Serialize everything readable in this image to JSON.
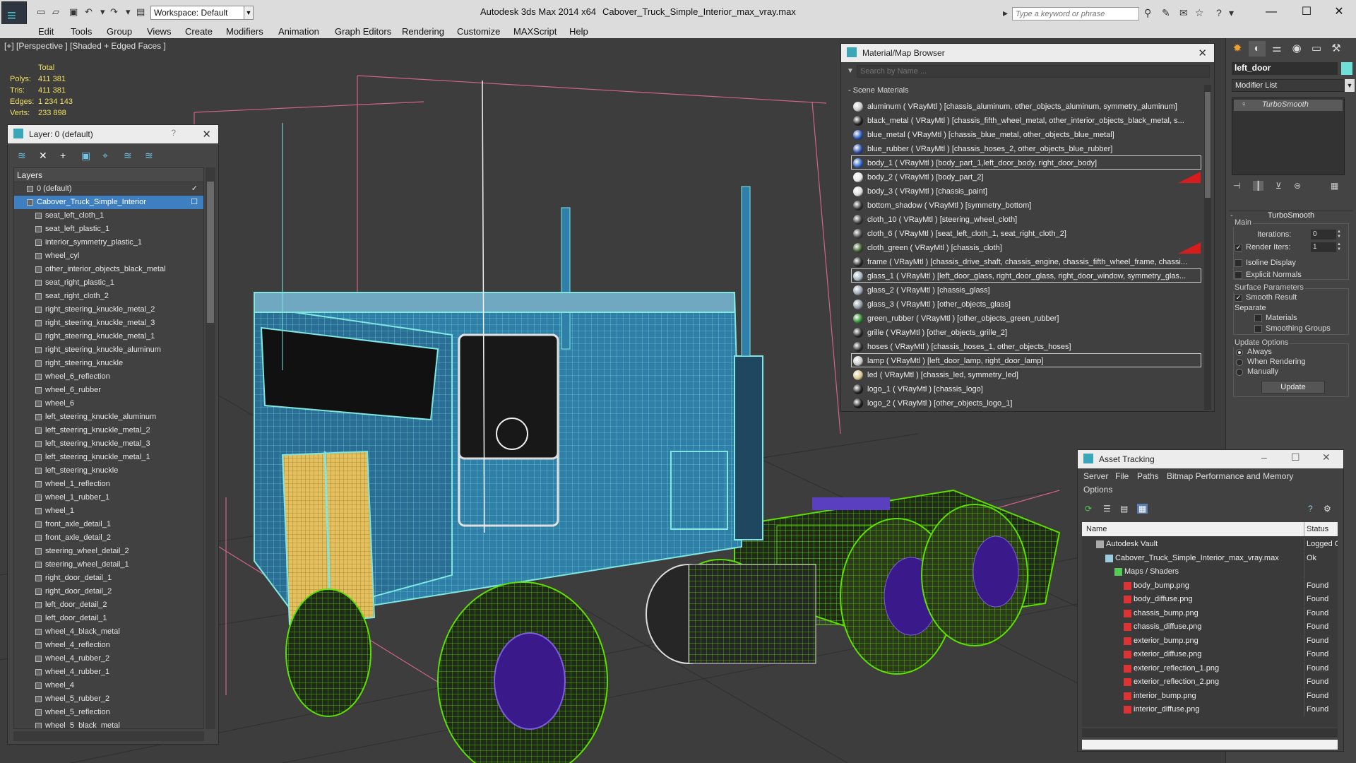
{
  "titlebar": {
    "workspace": "Workspace: Default",
    "app_title": "Autodesk 3ds Max  2014 x64",
    "file_title": "Cabover_Truck_Simple_Interior_max_vray.max",
    "search_placeholder": "Type a keyword or phrase",
    "minimize": "—",
    "maximize": "☐",
    "close": "✕"
  },
  "menubar": [
    "Edit",
    "Tools",
    "Group",
    "Views",
    "Create",
    "Modifiers",
    "Animation",
    "Graph Editors",
    "Rendering",
    "Customize",
    "MAXScript",
    "Help"
  ],
  "viewport": {
    "label": "[+] [Perspective ] [Shaded + Edged Faces ]",
    "stats": {
      "total_label": "Total",
      "polys_label": "Polys:",
      "polys": "411 381",
      "tris_label": "Tris:",
      "tris": "411 381",
      "edges_label": "Edges:",
      "edges": "1 234 143",
      "verts_label": "Verts:",
      "verts": "233 898"
    }
  },
  "layer_panel": {
    "title": "Layer: 0 (default)",
    "help": "?",
    "close": "✕",
    "header": "Layers",
    "items": [
      {
        "label": "0 (default)",
        "level": 0,
        "check": "✓"
      },
      {
        "label": "Cabover_Truck_Simple_Interior",
        "level": 0,
        "selected": true,
        "check": "☐"
      },
      {
        "label": "seat_left_cloth_1",
        "level": 1
      },
      {
        "label": "seat_left_plastic_1",
        "level": 1
      },
      {
        "label": "interior_symmetry_plastic_1",
        "level": 1
      },
      {
        "label": "wheel_cyl",
        "level": 1
      },
      {
        "label": "other_interior_objects_black_metal",
        "level": 1
      },
      {
        "label": "seat_right_plastic_1",
        "level": 1
      },
      {
        "label": "seat_right_cloth_2",
        "level": 1
      },
      {
        "label": "right_steering_knuckle_metal_2",
        "level": 1
      },
      {
        "label": "right_steering_knuckle_metal_3",
        "level": 1
      },
      {
        "label": "right_steering_knuckle_metal_1",
        "level": 1
      },
      {
        "label": "right_steering_knuckle_aluminum",
        "level": 1
      },
      {
        "label": "right_steering_knuckle",
        "level": 1
      },
      {
        "label": "wheel_6_reflection",
        "level": 1
      },
      {
        "label": "wheel_6_rubber",
        "level": 1
      },
      {
        "label": "wheel_6",
        "level": 1
      },
      {
        "label": "left_steering_knuckle_aluminum",
        "level": 1
      },
      {
        "label": "left_steering_knuckle_metal_2",
        "level": 1
      },
      {
        "label": "left_steering_knuckle_metal_3",
        "level": 1
      },
      {
        "label": "left_steering_knuckle_metal_1",
        "level": 1
      },
      {
        "label": "left_steering_knuckle",
        "level": 1
      },
      {
        "label": "wheel_1_reflection",
        "level": 1
      },
      {
        "label": "wheel_1_rubber_1",
        "level": 1
      },
      {
        "label": "wheel_1",
        "level": 1
      },
      {
        "label": "front_axle_detail_1",
        "level": 1
      },
      {
        "label": "front_axle_detail_2",
        "level": 1
      },
      {
        "label": "steering_wheel_detail_2",
        "level": 1
      },
      {
        "label": "steering_wheel_detail_1",
        "level": 1
      },
      {
        "label": "right_door_detail_1",
        "level": 1
      },
      {
        "label": "right_door_detail_2",
        "level": 1
      },
      {
        "label": "left_door_detail_2",
        "level": 1
      },
      {
        "label": "left_door_detail_1",
        "level": 1
      },
      {
        "label": "wheel_4_black_metal",
        "level": 1
      },
      {
        "label": "wheel_4_reflection",
        "level": 1
      },
      {
        "label": "wheel_4_rubber_2",
        "level": 1
      },
      {
        "label": "wheel_4_rubber_1",
        "level": 1
      },
      {
        "label": "wheel_4",
        "level": 1
      },
      {
        "label": "wheel_5_rubber_2",
        "level": 1
      },
      {
        "label": "wheel_5_reflection",
        "level": 1
      },
      {
        "label": "wheel_5_black_metal",
        "level": 1
      }
    ]
  },
  "material_browser": {
    "title": "Material/Map Browser",
    "close": "✕",
    "search_placeholder": "Search by Name ...",
    "group": "- Scene Materials",
    "items": [
      {
        "label": "aluminum  ( VRayMtl ) [chassis_aluminum, other_objects_aluminum, symmetry_aluminum]",
        "color": "#c9c9c9"
      },
      {
        "label": "black_metal  ( VRayMtl ) [chassis_fifth_wheel_metal, other_interior_objects_black_metal, s...",
        "color": "#222222"
      },
      {
        "label": "blue_metal  ( VRayMtl ) [chassis_blue_metal, other_objects_blue_metal]",
        "color": "#2a58b8"
      },
      {
        "label": "blue_rubber  ( VRayMtl ) [chassis_hoses_2, other_objects_blue_rubber]",
        "color": "#2b4fa8"
      },
      {
        "label": "body_1  ( VRayMtl ) [body_part_1,left_door_body, right_door_body]",
        "color": "#2f66c4",
        "boxed": true
      },
      {
        "label": "body_2  ( VRayMtl ) [body_part_2]",
        "color": "#e8e8e8",
        "flag": true
      },
      {
        "label": "body_3  ( VRayMtl ) [chassis_paint]",
        "color": "#dddddd"
      },
      {
        "label": "bottom_shadow  ( VRayMtl ) [symmetry_bottom]",
        "color": "#333333"
      },
      {
        "label": "cloth_10  ( VRayMtl ) [steering_wheel_cloth]",
        "color": "#3a3a3a"
      },
      {
        "label": "cloth_6  ( VRayMtl ) [seat_left_cloth_1, seat_right_cloth_2]",
        "color": "#444444"
      },
      {
        "label": "cloth_green  ( VRayMtl ) [chassis_cloth]",
        "color": "#3d5a2a",
        "flag": true
      },
      {
        "label": "frame  ( VRayMtl ) [chassis_drive_shaft, chassis_engine, chassis_fifth_wheel_frame, chassi...",
        "color": "#2a2a2a"
      },
      {
        "label": "glass_1  ( VRayMtl ) [left_door_glass, right_door_glass, right_door_window, symmetry_glas...",
        "color": "#a8b4c0",
        "boxed": true
      },
      {
        "label": "glass_2  ( VRayMtl ) [chassis_glass]",
        "color": "#9aa4ae"
      },
      {
        "label": "glass_3  ( VRayMtl ) [other_objects_glass]",
        "color": "#8e98a2"
      },
      {
        "label": "green_rubber  ( VRayMtl ) [other_objects_green_rubber]",
        "color": "#2f8a2f"
      },
      {
        "label": "grille  ( VRayMtl ) [other_objects_grille_2]",
        "color": "#2c2c2c"
      },
      {
        "label": "hoses  ( VRayMtl ) [chassis_hoses_1, other_objects_hoses]",
        "color": "#303030"
      },
      {
        "label": "lamp  ( VRayMtl ) [left_door_lamp, right_door_lamp]",
        "color": "#cccccc",
        "boxed": true
      },
      {
        "label": "led  ( VRayMtl ) [chassis_led, symmetry_led]",
        "color": "#d8c890"
      },
      {
        "label": "logo_1  ( VRayMtl ) [chassis_logo]",
        "color": "#222222"
      },
      {
        "label": "logo_2  ( VRayMtl ) [other_objects_logo_1]",
        "color": "#1e1e1e"
      }
    ]
  },
  "command_panel": {
    "object_name": "left_door",
    "modifier_list": "Modifier List",
    "stack_item": "TurboSmooth",
    "rollout_title": "TurboSmooth",
    "main_label": "Main",
    "iterations_label": "Iterations:",
    "iterations": "0",
    "render_iters_label": "Render Iters:",
    "render_iters": "1",
    "isoline": "Isoline Display",
    "explicit_normals": "Explicit Normals",
    "surface_params": "Surface Parameters",
    "smooth_result": "Smooth Result",
    "separate": "Separate",
    "materials": "Materials",
    "smoothing_groups": "Smoothing Groups",
    "update_options": "Update Options",
    "always": "Always",
    "when_rendering": "When Rendering",
    "manually": "Manually",
    "update_button": "Update",
    "object_color": "#6ee0d8"
  },
  "asset_tracking": {
    "title": "Asset Tracking",
    "menus": [
      "Server",
      "File",
      "Paths",
      "Bitmap Performance and Memory",
      "Options"
    ],
    "col_name": "Name",
    "col_status": "Status",
    "rows": [
      {
        "name": "Autodesk Vault",
        "status": "Logged O",
        "level": 0
      },
      {
        "name": "Cabover_Truck_Simple_Interior_max_vray.max",
        "status": "Ok",
        "level": 1
      },
      {
        "name": "Maps / Shaders",
        "status": "",
        "level": 2
      },
      {
        "name": "body_bump.png",
        "status": "Found",
        "level": 3
      },
      {
        "name": "body_diffuse.png",
        "status": "Found",
        "level": 3
      },
      {
        "name": "chassis_bump.png",
        "status": "Found",
        "level": 3
      },
      {
        "name": "chassis_diffuse.png",
        "status": "Found",
        "level": 3
      },
      {
        "name": "exterior_bump.png",
        "status": "Found",
        "level": 3
      },
      {
        "name": "exterior_diffuse.png",
        "status": "Found",
        "level": 3
      },
      {
        "name": "exterior_reflection_1.png",
        "status": "Found",
        "level": 3
      },
      {
        "name": "exterior_reflection_2.png",
        "status": "Found",
        "level": 3
      },
      {
        "name": "interior_bump.png",
        "status": "Found",
        "level": 3
      },
      {
        "name": "interior_diffuse.png",
        "status": "Found",
        "level": 3
      }
    ]
  }
}
